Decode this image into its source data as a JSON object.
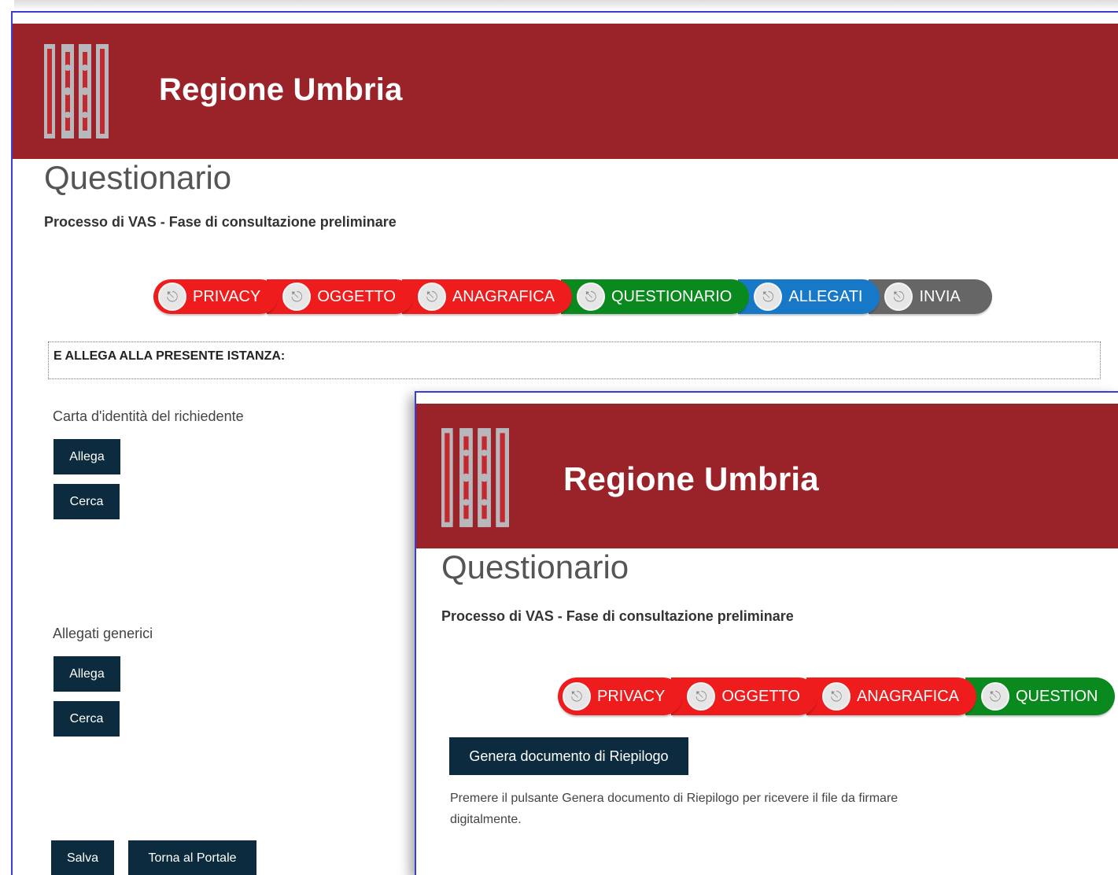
{
  "brand": "Regione Umbria",
  "page_title": "Questionario",
  "subtitle": "Processo di VAS - Fase di consultazione preliminare",
  "colors": {
    "header": "#9a232a",
    "button": "#0d2b3e",
    "step_red": "#ee1c1c",
    "step_green": "#0a8a1e",
    "step_blue": "#1878c8",
    "step_gray": "#666666"
  },
  "steps": [
    {
      "label": "PRIVACY",
      "color": "#ee1c1c",
      "icon": "paint-bucket-icon"
    },
    {
      "label": "OGGETTO",
      "color": "#ee1c1c",
      "icon": "paint-bucket-icon"
    },
    {
      "label": "ANAGRAFICA",
      "color": "#ee1c1c",
      "icon": "paint-bucket-icon"
    },
    {
      "label": "QUESTIONARIO",
      "color": "#0a8a1e",
      "icon": "paint-bucket-icon"
    },
    {
      "label": "ALLEGATI",
      "color": "#1878c8",
      "icon": "paint-bucket-icon"
    },
    {
      "label": "INVIA",
      "color": "#666666",
      "icon": "paint-bucket-icon"
    }
  ],
  "window2_steps": [
    {
      "label": "PRIVACY",
      "color": "#ee1c1c"
    },
    {
      "label": "OGGETTO",
      "color": "#ee1c1c"
    },
    {
      "label": "ANAGRAFICA",
      "color": "#ee1c1c"
    },
    {
      "label": "QUESTION",
      "color": "#0a8a1e"
    }
  ],
  "section_heading": "E ALLEGA ALLA PRESENTE ISTANZA:",
  "attachments": [
    {
      "label": "Carta d'identità del richiedente",
      "attach": "Allega",
      "search": "Cerca"
    },
    {
      "label": "Allegati generici",
      "attach": "Allega",
      "search": "Cerca"
    }
  ],
  "footer_buttons": {
    "save": "Salva",
    "portal": "Torna al Portale"
  },
  "summary": {
    "button": "Genera documento di Riepilogo",
    "help_line1": "Premere il pulsante Genera documento di Riepilogo per ricevere il file da firmare",
    "help_line2": "digitalmente."
  }
}
